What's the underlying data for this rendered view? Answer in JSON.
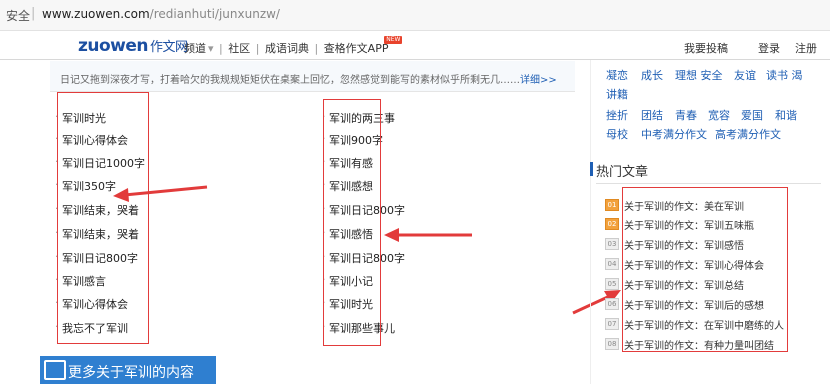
{
  "address_bar": {
    "secure_label": "安全",
    "url_domain": "www.zuowen.com",
    "url_path": "/redianhuti/junxunzw/"
  },
  "navbar": {
    "logo": "zuowen",
    "logo_cn": "作文网",
    "channel": "频道",
    "links": [
      "社区",
      "成语词典",
      "查格作文APP"
    ],
    "badge": "NEW",
    "submit": "我要投稿",
    "login": "登录",
    "register": "注册"
  },
  "intro": {
    "text": "日记又拖到深夜才写，打着哈欠的我规规矩矩伏在桌案上回忆，忽然感觉到能写的素材似乎所剩无几……",
    "more": "详细>>"
  },
  "articles": {
    "left": [
      "军训时光",
      "军训心得体会",
      "军训日记1000字",
      "军训350字",
      "军训结束，哭着",
      "军训结束，哭着",
      "军训日记800字",
      "军训感言",
      "军训心得体会",
      "我忘不了军训"
    ],
    "right": [
      "军训的两三事",
      "军训900字",
      "军训有感",
      "军训感想",
      "军训日记800字",
      "军训感悟",
      "军训日记800字",
      "军训小记",
      "军训时光",
      "军训那些事儿"
    ]
  },
  "bottom_bar": {
    "title": "更多关于军训的内容"
  },
  "sidebar": {
    "tag_rows": [
      [
        "凝恋",
        "成长",
        "理想 安全",
        "友谊",
        "读书 渴"
      ],
      [
        "讲籍"
      ],
      [
        "挫折",
        "团结",
        "青春",
        "宽容",
        "爱国",
        "和谐"
      ],
      [
        "母校",
        "中考满分作文",
        "高考满分作文"
      ]
    ],
    "hot_title": "热门文章",
    "hot_articles": [
      {
        "rank": "01",
        "title": "关于军训的作文：美在军训"
      },
      {
        "rank": "02",
        "title": "关于军训的作文：军训五味瓶"
      },
      {
        "rank": "03",
        "title": "关于军训的作文：军训感悟"
      },
      {
        "rank": "04",
        "title": "关于军训的作文：军训心得体会"
      },
      {
        "rank": "05",
        "title": "关于军训的作文：军训总结"
      },
      {
        "rank": "06",
        "title": "关于军训的作文：军训后的感想"
      },
      {
        "rank": "07",
        "title": "关于军训的作文：在军训中磨练的人"
      },
      {
        "rank": "08",
        "title": "关于军训的作文：有种力量叫团结"
      }
    ]
  },
  "colors": {
    "annotation_red": "#e23b3b",
    "link_blue": "#1f5fb4",
    "hot_rank_orange": "#f2a13c",
    "bottom_bar_blue": "#2f7fd0"
  }
}
